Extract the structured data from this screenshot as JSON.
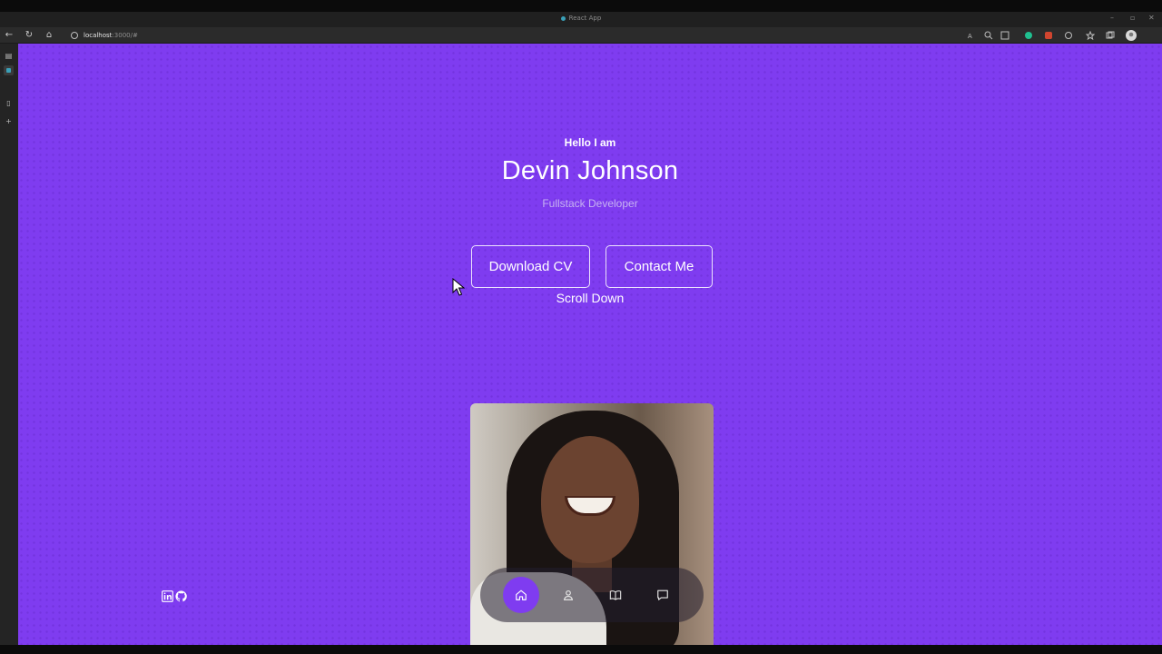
{
  "browser": {
    "tab_title": "React App",
    "url_host": "localhost",
    "url_rest": ":3000/#"
  },
  "hero": {
    "greeting": "Hello I am",
    "name": "Devin Johnson",
    "role": "Fullstack Developer",
    "download_cv_label": "Download CV",
    "contact_label": "Contact Me",
    "scroll_label": "Scroll Down"
  },
  "nav": {
    "items": [
      "home-icon",
      "user-icon",
      "book-icon",
      "message-icon"
    ],
    "active": "home-icon"
  },
  "socials": [
    "linkedin-icon",
    "github-icon"
  ],
  "colors": {
    "accent": "#7f3cf0",
    "nav_bg": "#231e2d",
    "role_text": "#c7b2f2"
  }
}
